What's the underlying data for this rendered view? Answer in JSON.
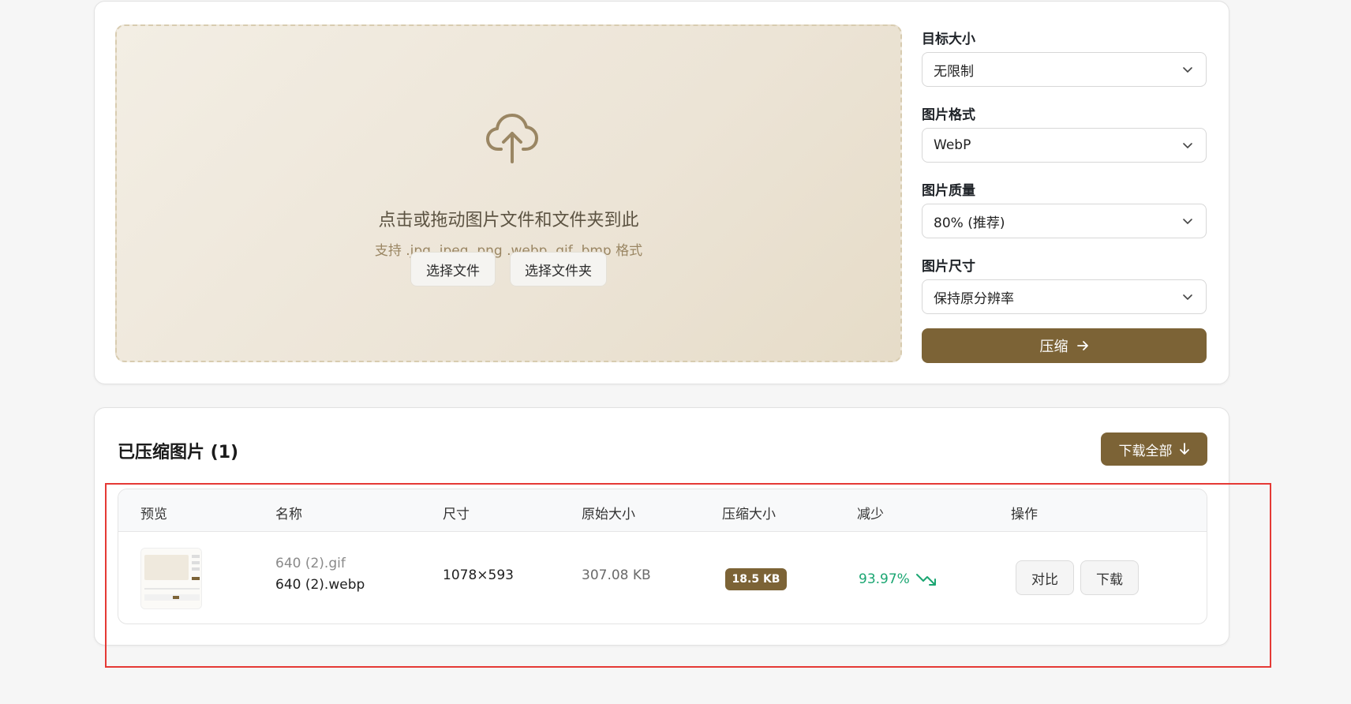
{
  "colors": {
    "accent": "#7c6336",
    "success": "#1ba672",
    "highlight": "#e53935"
  },
  "upload": {
    "icon": "cloud-upload-icon",
    "title": "点击或拖动图片文件和文件夹到此",
    "subtitle": "支持 .jpg .jpeg .png .webp .gif .bmp 格式",
    "select_files": "选择文件",
    "select_folder": "选择文件夹"
  },
  "settings": {
    "target_size": {
      "label": "目标大小",
      "value": "无限制"
    },
    "format": {
      "label": "图片格式",
      "value": "WebP"
    },
    "quality": {
      "label": "图片质量",
      "value": "80% (推荐)"
    },
    "dimensions": {
      "label": "图片尺寸",
      "value": "保持原分辨率"
    },
    "compress_button": "压缩"
  },
  "results": {
    "title": "已压缩图片 (1)",
    "download_all": "下载全部",
    "columns": [
      "预览",
      "名称",
      "尺寸",
      "原始大小",
      "压缩大小",
      "减少",
      "操作"
    ],
    "rows": [
      {
        "original_name": "640 (2).gif",
        "new_name": "640 (2).webp",
        "dimensions": "1078×593",
        "original_size": "307.08 KB",
        "compressed_size": "18.5 KB",
        "reduction": "93.97%",
        "compare_label": "对比",
        "download_label": "下载"
      }
    ]
  }
}
